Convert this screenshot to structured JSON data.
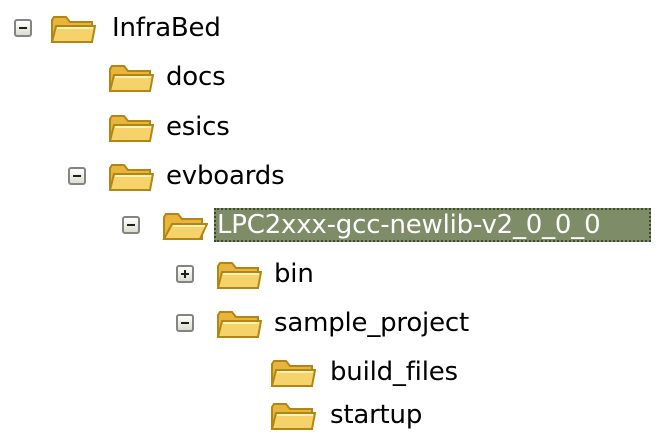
{
  "tree": {
    "nodes": [
      {
        "name": "InfraBed",
        "expander": "minus",
        "selected": false
      },
      {
        "name": "docs",
        "expander": "none",
        "selected": false
      },
      {
        "name": "esics",
        "expander": "none",
        "selected": false
      },
      {
        "name": "evboards",
        "expander": "minus",
        "selected": false
      },
      {
        "name": "LPC2xxx-gcc-newlib-v2_0_0_0",
        "expander": "minus",
        "selected": true
      },
      {
        "name": "bin",
        "expander": "plus",
        "selected": false
      },
      {
        "name": "sample_project",
        "expander": "minus",
        "selected": false
      },
      {
        "name": "build_files",
        "expander": "none",
        "selected": false
      },
      {
        "name": "startup",
        "expander": "none",
        "selected": false
      }
    ]
  },
  "colors": {
    "selection_bg": "#7f8c68",
    "folder_fill": "#f6d36a",
    "folder_stroke": "#b38614"
  },
  "icons": {
    "folder": "folder-icon",
    "collapse": "minus-box-icon",
    "expand": "plus-box-icon"
  }
}
